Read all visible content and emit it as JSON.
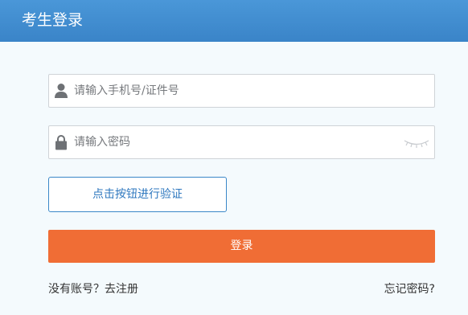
{
  "header": {
    "title": "考生登录"
  },
  "form": {
    "phone_placeholder": "请输入手机号/证件号",
    "phone_value": "",
    "password_placeholder": "请输入密码",
    "password_value": "",
    "verify_button_label": "点击按钮进行验证",
    "login_button_label": "登录"
  },
  "links": {
    "register": "没有账号？去注册",
    "forgot_password": "忘记密码?"
  },
  "icons": {
    "phone_field": "user-icon",
    "password_field": "lock-icon",
    "password_toggle": "eye-closed-icon"
  },
  "colors": {
    "header": "#3a84c8",
    "accent_blue": "#3a87c8",
    "login_button": "#f06d35",
    "background": "#f4fafd"
  }
}
